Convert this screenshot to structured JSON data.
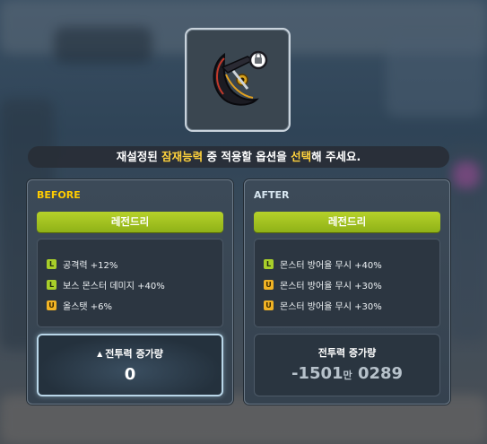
{
  "item": {
    "icon": "dark-scythe-weapon-icon"
  },
  "prompt": {
    "part1": "재설정된 ",
    "highlight1": "잠재능력",
    "part2": " 중 적용할 옵션을 ",
    "highlight2": "선택",
    "part3": "해 주세요."
  },
  "before": {
    "title": "BEFORE",
    "grade": "레전드리",
    "options": [
      {
        "tier": "L",
        "text": "공격력 +12%"
      },
      {
        "tier": "L",
        "text": "보스 몬스터 데미지 +40%"
      },
      {
        "tier": "U",
        "text": "올스탯 +6%"
      }
    ],
    "power_label": "전투력 증가량",
    "power_value": "0"
  },
  "after": {
    "title": "AFTER",
    "grade": "레전드리",
    "options": [
      {
        "tier": "L",
        "text": "몬스터 방어율 무시 +40%"
      },
      {
        "tier": "U",
        "text": "몬스터 방어율 무시 +30%"
      },
      {
        "tier": "U",
        "text": "몬스터 방어율 무시 +30%"
      }
    ],
    "power_label": "전투력 증가량",
    "power_value_main": "-1501",
    "power_value_unit": "만",
    "power_value_tail": "0289"
  },
  "colors": {
    "legendary": "#a8cf2a",
    "unique": "#f1b324",
    "highlight": "#ffd23c",
    "before_title": "#ffcc00"
  }
}
